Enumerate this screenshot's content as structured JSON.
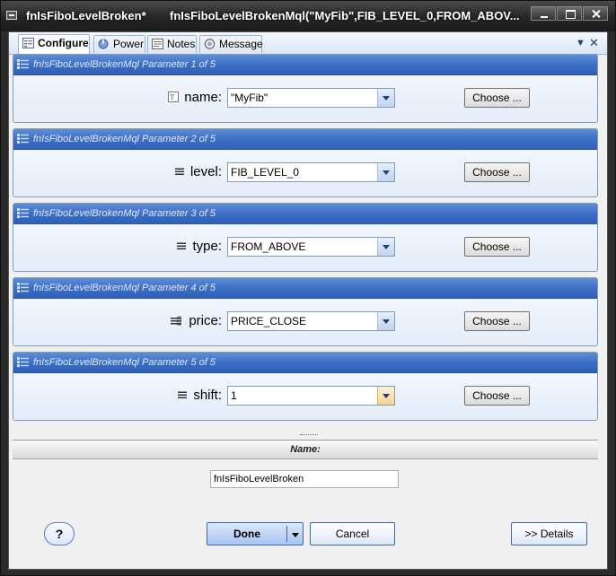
{
  "window": {
    "title": "fnIsFiboLevelBroken*",
    "subtitle": "fnIsFiboLevelBrokenMql(\"MyFib\",FIB_LEVEL_0,FROM_ABOV..."
  },
  "tabs": [
    {
      "label": "Configure",
      "icon": "configure-icon",
      "active": true
    },
    {
      "label": "Power",
      "icon": "power-icon",
      "active": false
    },
    {
      "label": "Notes",
      "icon": "notes-icon",
      "active": false
    },
    {
      "label": "Message",
      "icon": "message-icon",
      "active": false
    }
  ],
  "parameters": [
    {
      "header": "fnIsFiboLevelBrokenMql Parameter 1 of 5",
      "label": "name:",
      "value": "\"MyFib\"",
      "choose_label": "Choose ...",
      "icon": "text-type-icon"
    },
    {
      "header": "fnIsFiboLevelBrokenMql Parameter 2 of 5",
      "label": "level:",
      "value": "FIB_LEVEL_0",
      "choose_label": "Choose ...",
      "icon": "enum-type-icon"
    },
    {
      "header": "fnIsFiboLevelBrokenMql Parameter 3 of 5",
      "label": "type:",
      "value": "FROM_ABOVE",
      "choose_label": "Choose ...",
      "icon": "enum-type-icon"
    },
    {
      "header": "fnIsFiboLevelBrokenMql Parameter 4 of 5",
      "label": "price:",
      "value": "PRICE_CLOSE",
      "choose_label": "Choose ...",
      "icon": "price-type-icon"
    },
    {
      "header": "fnIsFiboLevelBrokenMql Parameter 5 of 5",
      "label": "shift:",
      "value": "1",
      "choose_label": "Choose ...",
      "icon": "enum-type-icon"
    }
  ],
  "name_section": {
    "header": "Name:",
    "value": "fnIsFiboLevelBroken"
  },
  "buttons": {
    "help": "?",
    "done": "Done",
    "cancel": "Cancel",
    "details": ">> Details"
  },
  "colors": {
    "panel_header": "#3d6fc6",
    "title_bar": "#262626",
    "accent_hot": "#f6d48c"
  }
}
